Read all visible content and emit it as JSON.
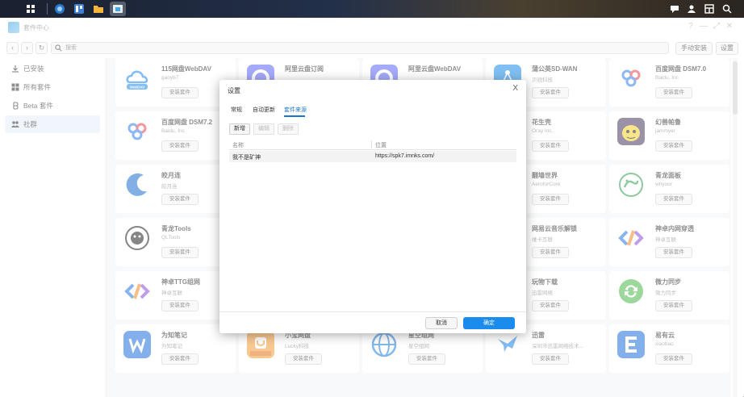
{
  "window": {
    "title": "套件中心",
    "search_placeholder": "搜索",
    "manual_install": "手动安装",
    "settings": "设置"
  },
  "sidebar": {
    "items": [
      {
        "label": "已安装",
        "icon": "download-icon"
      },
      {
        "label": "所有套件",
        "icon": "grid-icon"
      },
      {
        "label": "Beta 套件",
        "icon": "beta-icon"
      },
      {
        "label": "社群",
        "icon": "community-icon"
      }
    ]
  },
  "install_label": "安装套件",
  "cards": [
    {
      "name": "115网盘WebDAV",
      "vendor": "gaoyb7",
      "logo": "cloud-webdav",
      "color": "#1e88e5"
    },
    {
      "name": "阿里云盘订阅",
      "vendor": "",
      "logo": "aliyun",
      "color": "#5b64f6"
    },
    {
      "name": "阿里云盘WebDAV",
      "vendor": "",
      "logo": "aliyun",
      "color": "#5b64f6"
    },
    {
      "name": "蒲公英SD-WAN",
      "vendor": "贝锐科技",
      "logo": "pgy",
      "color": "#1b8ae8"
    },
    {
      "name": "百度网盘 DSM7.0",
      "vendor": "Baidu, Inc",
      "logo": "baidu",
      "color": "#2f7fee"
    },
    {
      "name": "百度网盘 DSM7.2",
      "vendor": "Baidu, Inc",
      "logo": "baidu",
      "color": "#2f7fee"
    },
    {
      "name": "花生壳",
      "vendor": "Oray Inc.",
      "logo": "oray",
      "color": "#ffffff"
    },
    {
      "name": "幻兽帕鲁",
      "vendor": "jammyer",
      "logo": "palworld",
      "color": "#f4d02a"
    },
    {
      "name": "皎月连",
      "vendor": "皎月连",
      "logo": "jiaoyue",
      "color": "#1d6fd0"
    },
    {
      "name": "翻墙世界",
      "vendor": "AeroforCore",
      "logo": "",
      "color": "#ffffff"
    },
    {
      "name": "青龙面板",
      "vendor": "whyour",
      "logo": "qinglong",
      "color": "#2e9e4f"
    },
    {
      "name": "青龙Tools",
      "vendor": "QLTools",
      "logo": "qltools",
      "color": "#222222"
    },
    {
      "name": "网易云音乐解锁",
      "vendor": "维卡互联",
      "logo": "",
      "color": "#ffffff"
    },
    {
      "name": "神卓内网穿透",
      "vendor": "神卓互联",
      "logo": "shenzhuo",
      "color": "#ffffff"
    },
    {
      "name": "神卓TTG组网",
      "vendor": "神卓互联",
      "logo": "shenzhuo",
      "color": "#ffffff"
    },
    {
      "name": "玩物下载",
      "vendor": "迅雷网络",
      "logo": "",
      "color": "#ffffff"
    },
    {
      "name": "微力同步",
      "vendor": "微力同步",
      "logo": "weili",
      "color": "#4cb849"
    },
    {
      "name": "为知笔记",
      "vendor": "为知笔记",
      "logo": "wiz",
      "color": "#1e6fdb"
    },
    {
      "name": "小宝网盘",
      "vendor": "Lucky科技",
      "logo": "xiaobao",
      "color": "#f59c37"
    },
    {
      "name": "星空组网",
      "vendor": "星空组网",
      "logo": "xingkong",
      "color": "#1e7fd8"
    },
    {
      "name": "迅雷",
      "vendor": "深圳市迅雷网络技术...",
      "logo": "xunlei",
      "color": "#1f86e6"
    },
    {
      "name": "易有云",
      "vendor": "xiaobao",
      "logo": "yiyou",
      "color": "#1e6fdb"
    }
  ],
  "dialog": {
    "title": "设置",
    "close": "X",
    "tabs": [
      "常规",
      "自动更新",
      "套件来源"
    ],
    "active_tab": 2,
    "add_label": "新增",
    "edit_label": "编辑",
    "delete_label": "删除",
    "columns": [
      "名称",
      "位置"
    ],
    "rows": [
      {
        "name": "我不是矿神",
        "url": "https://spk7.imnks.com/"
      }
    ],
    "cancel_label": "取消",
    "ok_label": "确定"
  }
}
